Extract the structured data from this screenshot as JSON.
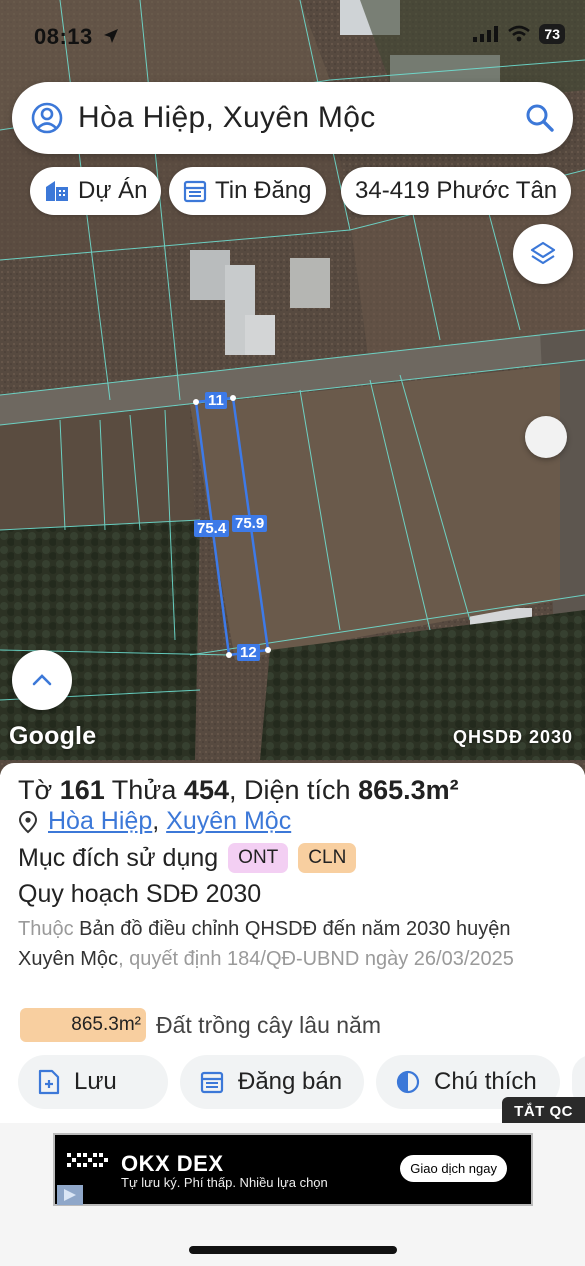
{
  "status_bar": {
    "time": "08:13",
    "battery": "73"
  },
  "search": {
    "query": "Hòa Hiệp, Xuyên Mộc"
  },
  "chips": [
    {
      "label": "Dự Án",
      "icon": "building-icon"
    },
    {
      "label": "Tin Đăng",
      "icon": "listing-icon"
    },
    {
      "label": "34-419 Phước Tân",
      "icon": ""
    }
  ],
  "map": {
    "attribution": "Google",
    "layer_label": "QHSDĐ 2030",
    "parcel_dims": {
      "top": "11",
      "bottom": "12",
      "left": "75.4",
      "right": "75.9"
    }
  },
  "parcel": {
    "sheet_label": "Tờ",
    "sheet_no": "161",
    "plot_label": "Thửa",
    "plot_no": "454",
    "area_label": "Diện tích",
    "area_value": "865.3m²",
    "commune": "Hòa Hiệp",
    "district": "Xuyên Mộc",
    "purpose_label": "Mục đích sử dụng",
    "purpose_codes": [
      "ONT",
      "CLN"
    ],
    "planning_title": "Quy hoạch SDĐ 2030",
    "desc_prefix": "Thuộc",
    "desc_doc": "Bản đồ điều chỉnh QHSDĐ đến năm 2030 huyện Xuyên Mộc",
    "desc_rest": ", quyết định 184/QĐ-UBND ngày 26/03/2025",
    "land_area": "865.3m²",
    "land_type": "Đất trồng cây lâu năm"
  },
  "actions": [
    {
      "label": "Lưu",
      "icon": "add-file-icon"
    },
    {
      "label": "Đăng bán",
      "icon": "calendar-list-icon"
    },
    {
      "label": "Chú thích",
      "icon": "half-circle-icon"
    }
  ],
  "ad": {
    "off_label": "TẮT QC",
    "title": "OKX DEX",
    "subtitle": "Tự lưu ký. Phí thấp. Nhiều lựa chọn",
    "cta": "Giao dịch ngay"
  },
  "colors": {
    "accent": "#3c78d8",
    "parcel_line": "#3d7ae8",
    "ont_badge": "#f3cff3",
    "cln_badge": "#f8cfa0"
  }
}
